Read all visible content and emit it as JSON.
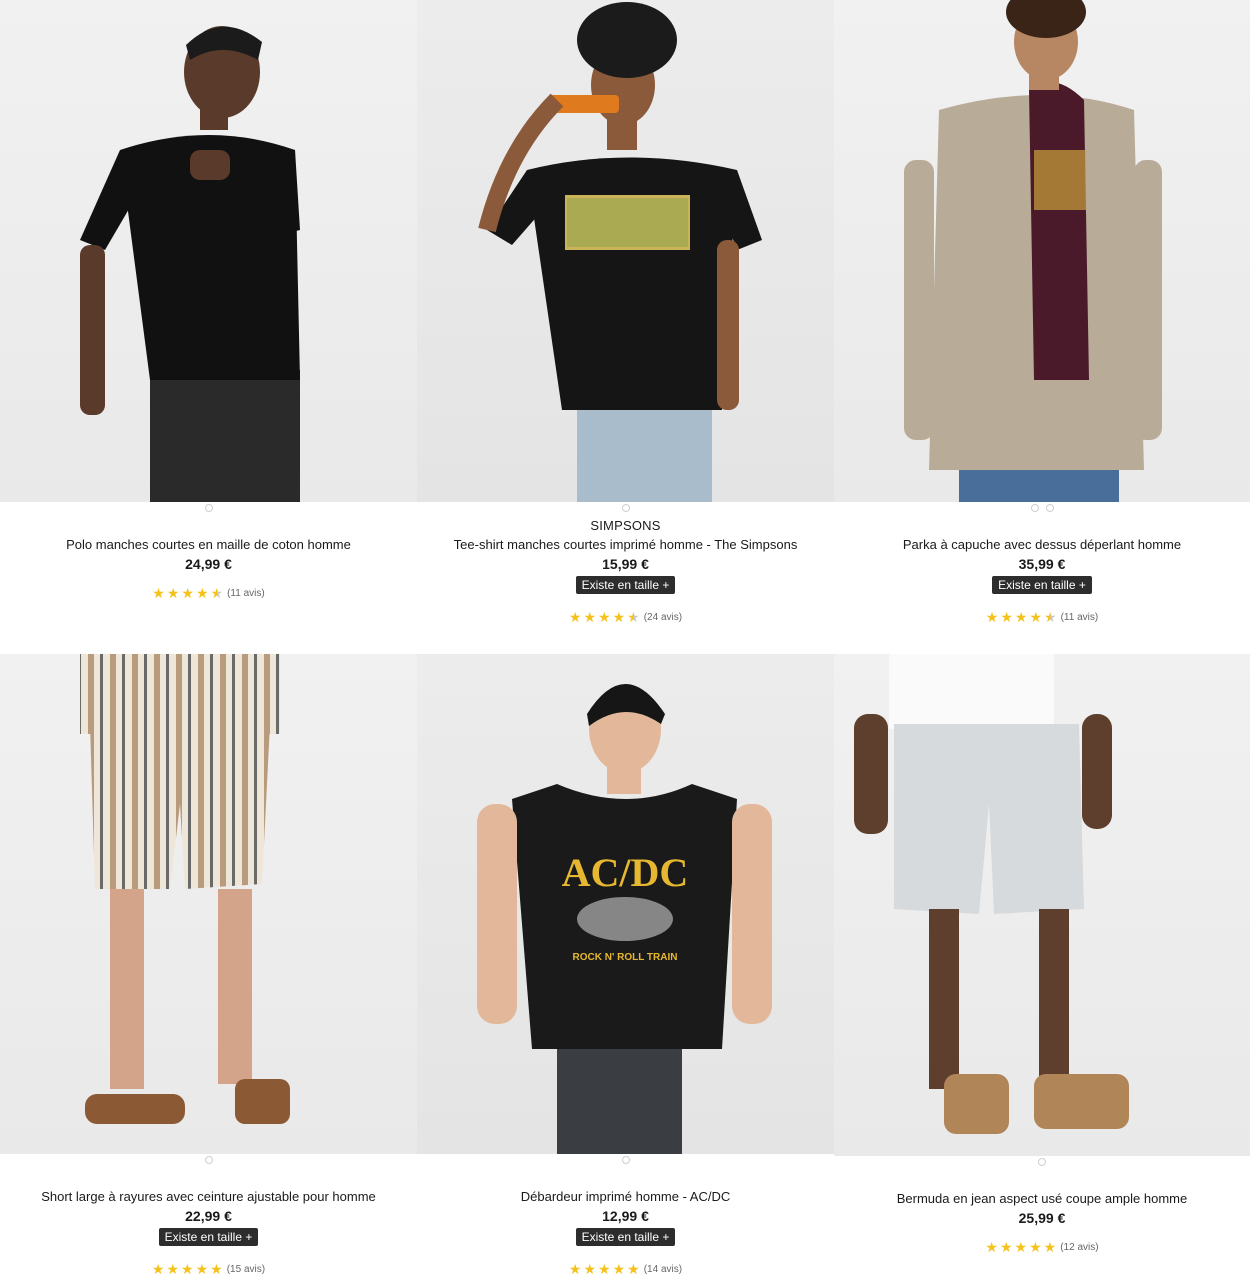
{
  "products": [
    {
      "brand": "",
      "title": "Polo manches courtes en maille de coton homme",
      "price": "24,99 €",
      "sizes_label": "",
      "rating": 4.5,
      "reviews": "(11 avis)",
      "dots": 1
    },
    {
      "brand": "SIMPSONS",
      "title": "Tee-shirt manches courtes imprimé homme - The Simpsons",
      "price": "15,99 €",
      "sizes_label": "Existe en taille +",
      "rating": 4.5,
      "reviews": "(24 avis)",
      "dots": 1
    },
    {
      "brand": "",
      "title": "Parka à capuche avec dessus déperlant homme",
      "price": "35,99 €",
      "sizes_label": "Existe en taille +",
      "rating": 4.5,
      "reviews": "(11 avis)",
      "dots": 2
    },
    {
      "brand": "",
      "title": "Short large à rayures avec ceinture ajustable pour homme",
      "price": "22,99 €",
      "sizes_label": "Existe en taille +",
      "rating": 5,
      "reviews": "(15 avis)",
      "dots": 1
    },
    {
      "brand": "",
      "title": "Débardeur imprimé homme - AC/DC",
      "price": "12,99 €",
      "sizes_label": "Existe en taille +",
      "rating": 5,
      "reviews": "(14 avis)",
      "dots": 1
    },
    {
      "brand": "",
      "title": "Bermuda en jean aspect usé coupe ample homme",
      "price": "25,99 €",
      "sizes_label": "",
      "rating": 5,
      "reviews": "(12 avis)",
      "dots": 1
    }
  ],
  "print_texts": {
    "acdc": "AC/DC",
    "acdc_sub": "ROCK N' ROLL TRAIN"
  },
  "colors": {
    "star": "#f4c21b",
    "badge_bg": "#2d2d2d"
  }
}
